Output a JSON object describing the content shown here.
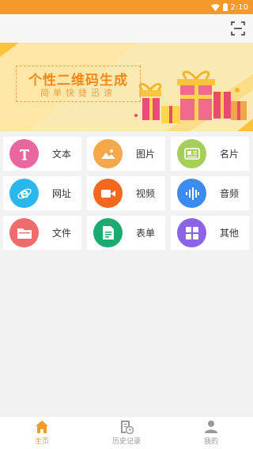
{
  "status_bar": {
    "time": "2:10",
    "icons": [
      "wifi-icon",
      "battery-icon"
    ]
  },
  "header": {
    "scan_icon": "scan-icon"
  },
  "banner": {
    "title": "个性二维码生成",
    "subtitle": "简单快捷迅速"
  },
  "grid": {
    "items": [
      {
        "label": "文本",
        "icon": "text-icon",
        "color": "#e8679f"
      },
      {
        "label": "图片",
        "icon": "image-icon",
        "color": "#f5a84a"
      },
      {
        "label": "名片",
        "icon": "card-icon",
        "color": "#a6cf5a"
      },
      {
        "label": "网址",
        "icon": "browser-icon",
        "color": "#2bb7ec"
      },
      {
        "label": "视频",
        "icon": "video-icon",
        "color": "#f2681f"
      },
      {
        "label": "音频",
        "icon": "audio-icon",
        "color": "#3c8bf0"
      },
      {
        "label": "文件",
        "icon": "folder-icon",
        "color": "#f06b6b"
      },
      {
        "label": "表单",
        "icon": "form-icon",
        "color": "#1aac6e"
      },
      {
        "label": "其他",
        "icon": "grid-icon",
        "color": "#8b63e8"
      }
    ]
  },
  "tabs": [
    {
      "label": "主页",
      "icon": "home-icon",
      "active": true
    },
    {
      "label": "历史记录",
      "icon": "history-icon",
      "active": false
    },
    {
      "label": "我的",
      "icon": "user-icon",
      "active": false
    }
  ],
  "colors": {
    "accent": "#f39a2e",
    "status_bar": "#f59a2a",
    "background": "#f2f2f2"
  }
}
